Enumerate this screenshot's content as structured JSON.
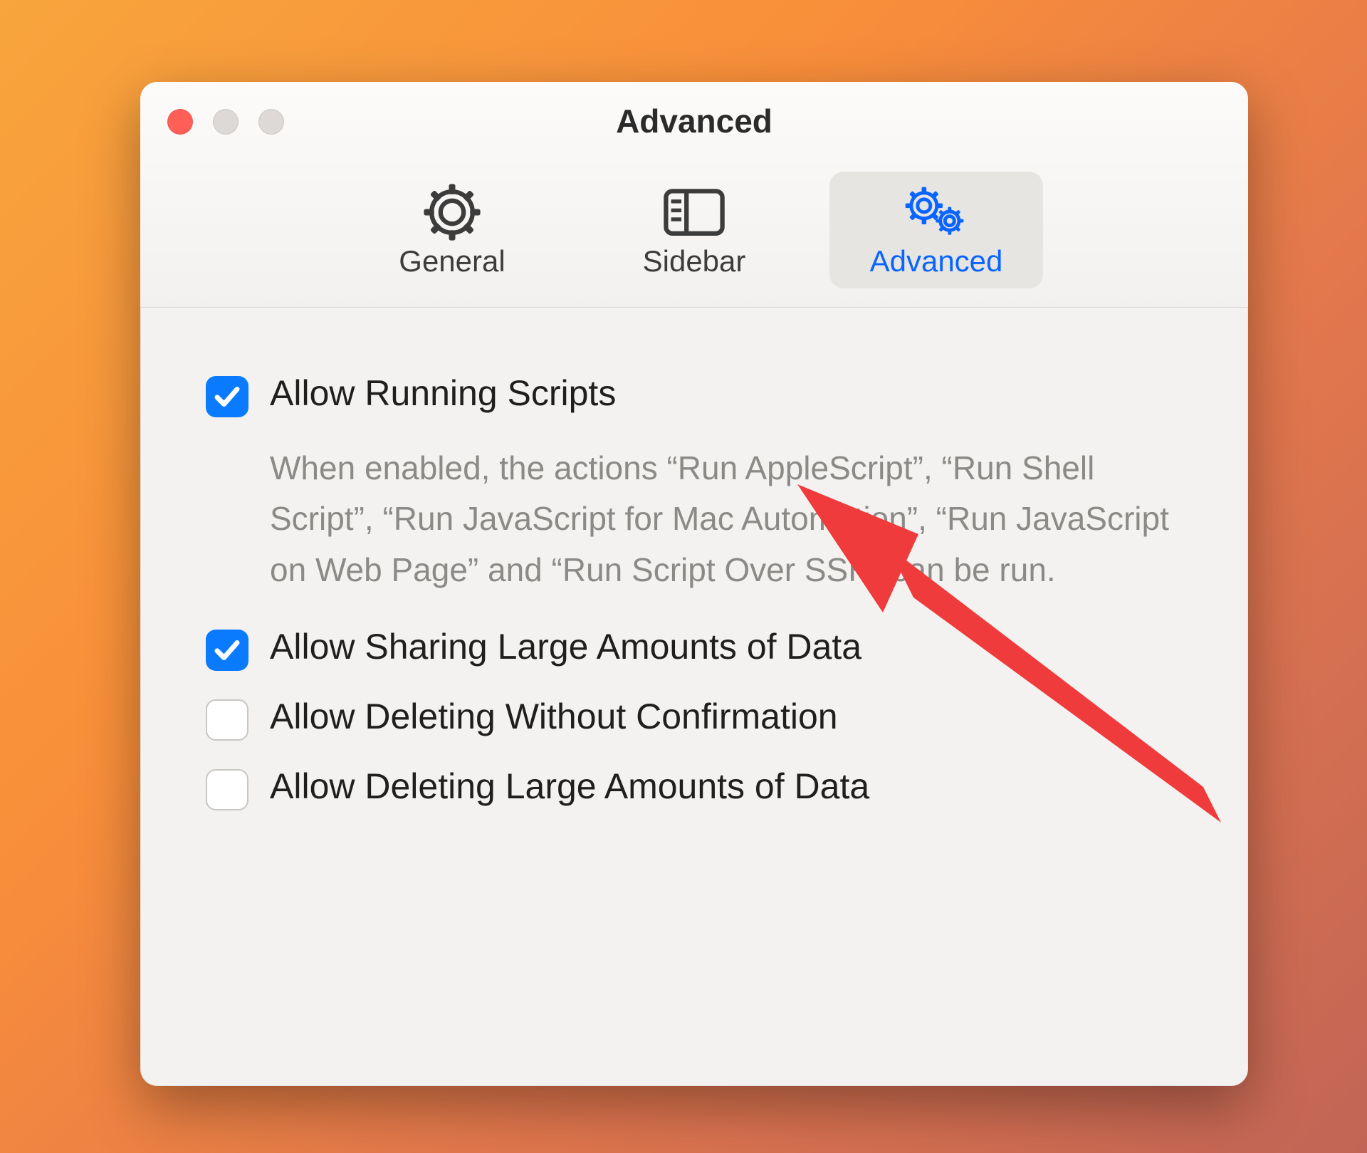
{
  "window": {
    "title": "Advanced"
  },
  "tabs": {
    "general": {
      "label": "General"
    },
    "sidebar": {
      "label": "Sidebar"
    },
    "advanced": {
      "label": "Advanced"
    }
  },
  "options": {
    "allow_scripts": {
      "label": "Allow Running Scripts",
      "checked": true,
      "description": "When enabled, the actions “Run AppleScript”, “Run Shell Script”, “Run JavaScript for Mac Automation”, “Run JavaScript on Web Page” and “Run Script Over SSH” can be run."
    },
    "allow_sharing_large": {
      "label": "Allow Sharing Large Amounts of Data",
      "checked": true
    },
    "allow_delete_noconfirm": {
      "label": "Allow Deleting Without Confirmation",
      "checked": false
    },
    "allow_delete_large": {
      "label": "Allow Deleting Large Amounts of Data",
      "checked": false
    }
  },
  "annotation": {
    "type": "arrow",
    "color": "#ef3b3b",
    "target": "allow_scripts"
  }
}
